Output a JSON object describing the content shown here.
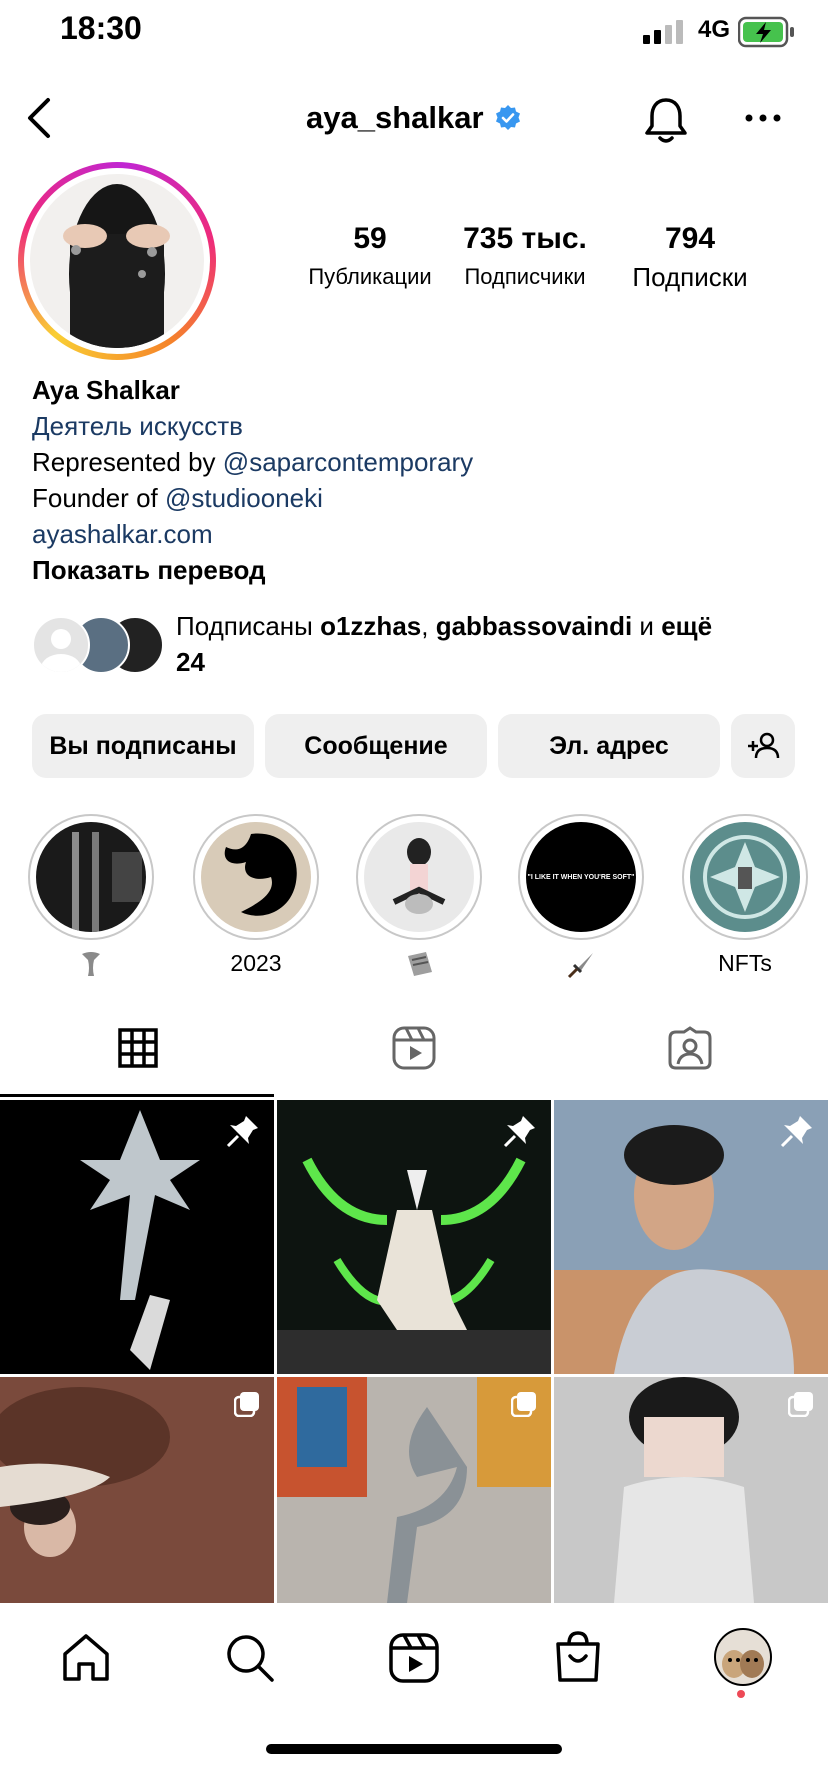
{
  "status_bar": {
    "time": "18:30",
    "network": "4G"
  },
  "header": {
    "username": "aya_shalkar"
  },
  "stats": [
    {
      "value": "59",
      "label": "Публикации"
    },
    {
      "value": "735 тыс.",
      "label": "Подписчики"
    },
    {
      "value": "794",
      "label": "Подписки"
    }
  ],
  "bio": {
    "name": "Aya Shalkar",
    "category": "Деятель искусств",
    "line1_prefix": "Represented by ",
    "line1_link": "@saparcontemporary",
    "line2_prefix": "Founder of ",
    "line2_link": "@studiooneki",
    "website": "ayashalkar.com",
    "translate": "Показать перевод"
  },
  "followed_by": {
    "prefix": "Подписаны ",
    "user1": "o1zzhas",
    "sep": ", ",
    "user2": "gabbassovaindi",
    "mid": " и ",
    "more": "ещё",
    "count": "24"
  },
  "actions": {
    "following": "Вы подписаны",
    "message": "Сообщение",
    "email": "Эл. адрес"
  },
  "highlights": [
    {
      "label": ""
    },
    {
      "label": "2023"
    },
    {
      "label": ""
    },
    {
      "label": ""
    },
    {
      "label": "NFTs"
    }
  ],
  "highlight_story_text": "\"I LIKE IT WHEN YOU'RE SOFT\"",
  "tabs": [
    "grid",
    "reels",
    "tagged"
  ],
  "colors": {
    "link": "#1b3a63",
    "verified": "#3897f0",
    "button_bg": "#efefef",
    "notification_dot": "#ed4956"
  }
}
